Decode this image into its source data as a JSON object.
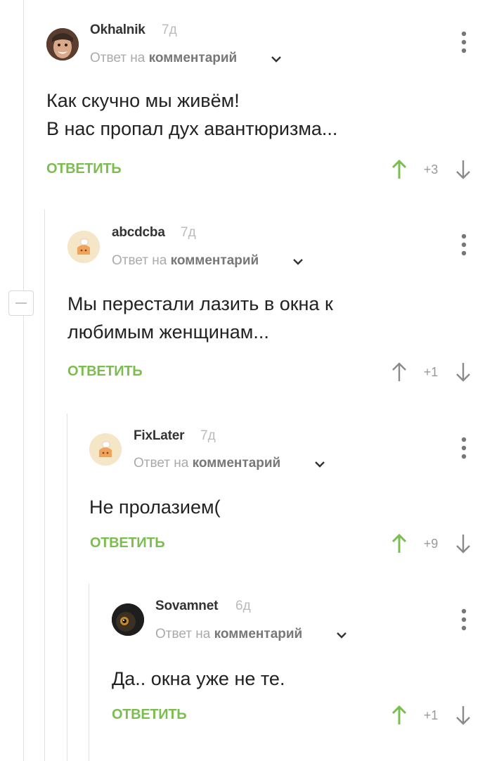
{
  "comments": [
    {
      "author": "Okhalnik",
      "time": "7д",
      "reply_prefix": "Ответ на",
      "reply_target": "комментарий",
      "text": "Как скучно мы живём!\nВ нас пропал дух авантюризма...",
      "reply_label": "ОТВЕТИТЬ",
      "rating": "+3",
      "avatar_icon": "user-photo",
      "upvoted": true
    },
    {
      "author": "abcdcba",
      "time": "7д",
      "reply_prefix": "Ответ на",
      "reply_target": "комментарий",
      "text": "Мы перестали лазить в окна к\nлюбимым женщинам...",
      "reply_label": "ОТВЕТИТЬ",
      "rating": "+1",
      "avatar_icon": "default-cake-avatar",
      "upvoted": false
    },
    {
      "author": "FixLater",
      "time": "7д",
      "reply_prefix": "Ответ на",
      "reply_target": "комментарий",
      "text": "Не пролазием(",
      "reply_label": "ОТВЕТИТЬ",
      "rating": "+9",
      "avatar_icon": "default-cake-avatar",
      "upvoted": true
    },
    {
      "author": "Sovamnet",
      "time": "6д",
      "reply_prefix": "Ответ на",
      "reply_target": "комментарий",
      "text": "Да.. окна уже не те.",
      "reply_label": "ОТВЕТИТЬ",
      "rating": "+1",
      "avatar_icon": "owl-photo",
      "upvoted": true
    }
  ],
  "colors": {
    "accent_green": "#7cbd4f",
    "neutral_arrow": "#8a8a8a",
    "thread_line": "#e2e2e2"
  }
}
